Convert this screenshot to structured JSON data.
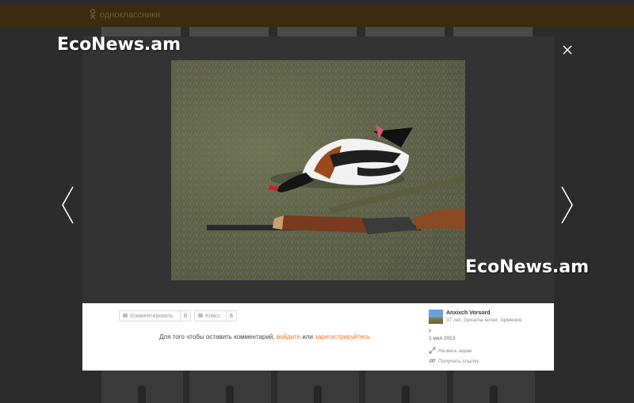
{
  "background": {
    "site_name": "одноклассники"
  },
  "viewer": {
    "close_label": "×",
    "prev_label": "previous photo",
    "next_label": "next photo"
  },
  "actions": {
    "comment_label": "Комментировать",
    "comment_count": "0",
    "like_label": "Класс",
    "like_count": "6"
  },
  "comment_prompt": {
    "prefix": "Для того чтобы оставить комментарий,",
    "login": "войдите",
    "or": "или",
    "register": "зарегистрируйтесь"
  },
  "author": {
    "name": "Anxixch Vorsord",
    "info": "37 лет, Gexama lerner, Армения",
    "extra": "у",
    "date": "1 мая 2013"
  },
  "links": {
    "fullscreen": "На весь экран",
    "get_link": "Получить ссылку"
  },
  "watermarks": {
    "top": "EcoNews.am",
    "bottom": "EcoNews.am"
  },
  "colors": {
    "accent": "#eb722e",
    "modal_bg": "#333333",
    "overlay_bg": "#2c2c2c"
  }
}
